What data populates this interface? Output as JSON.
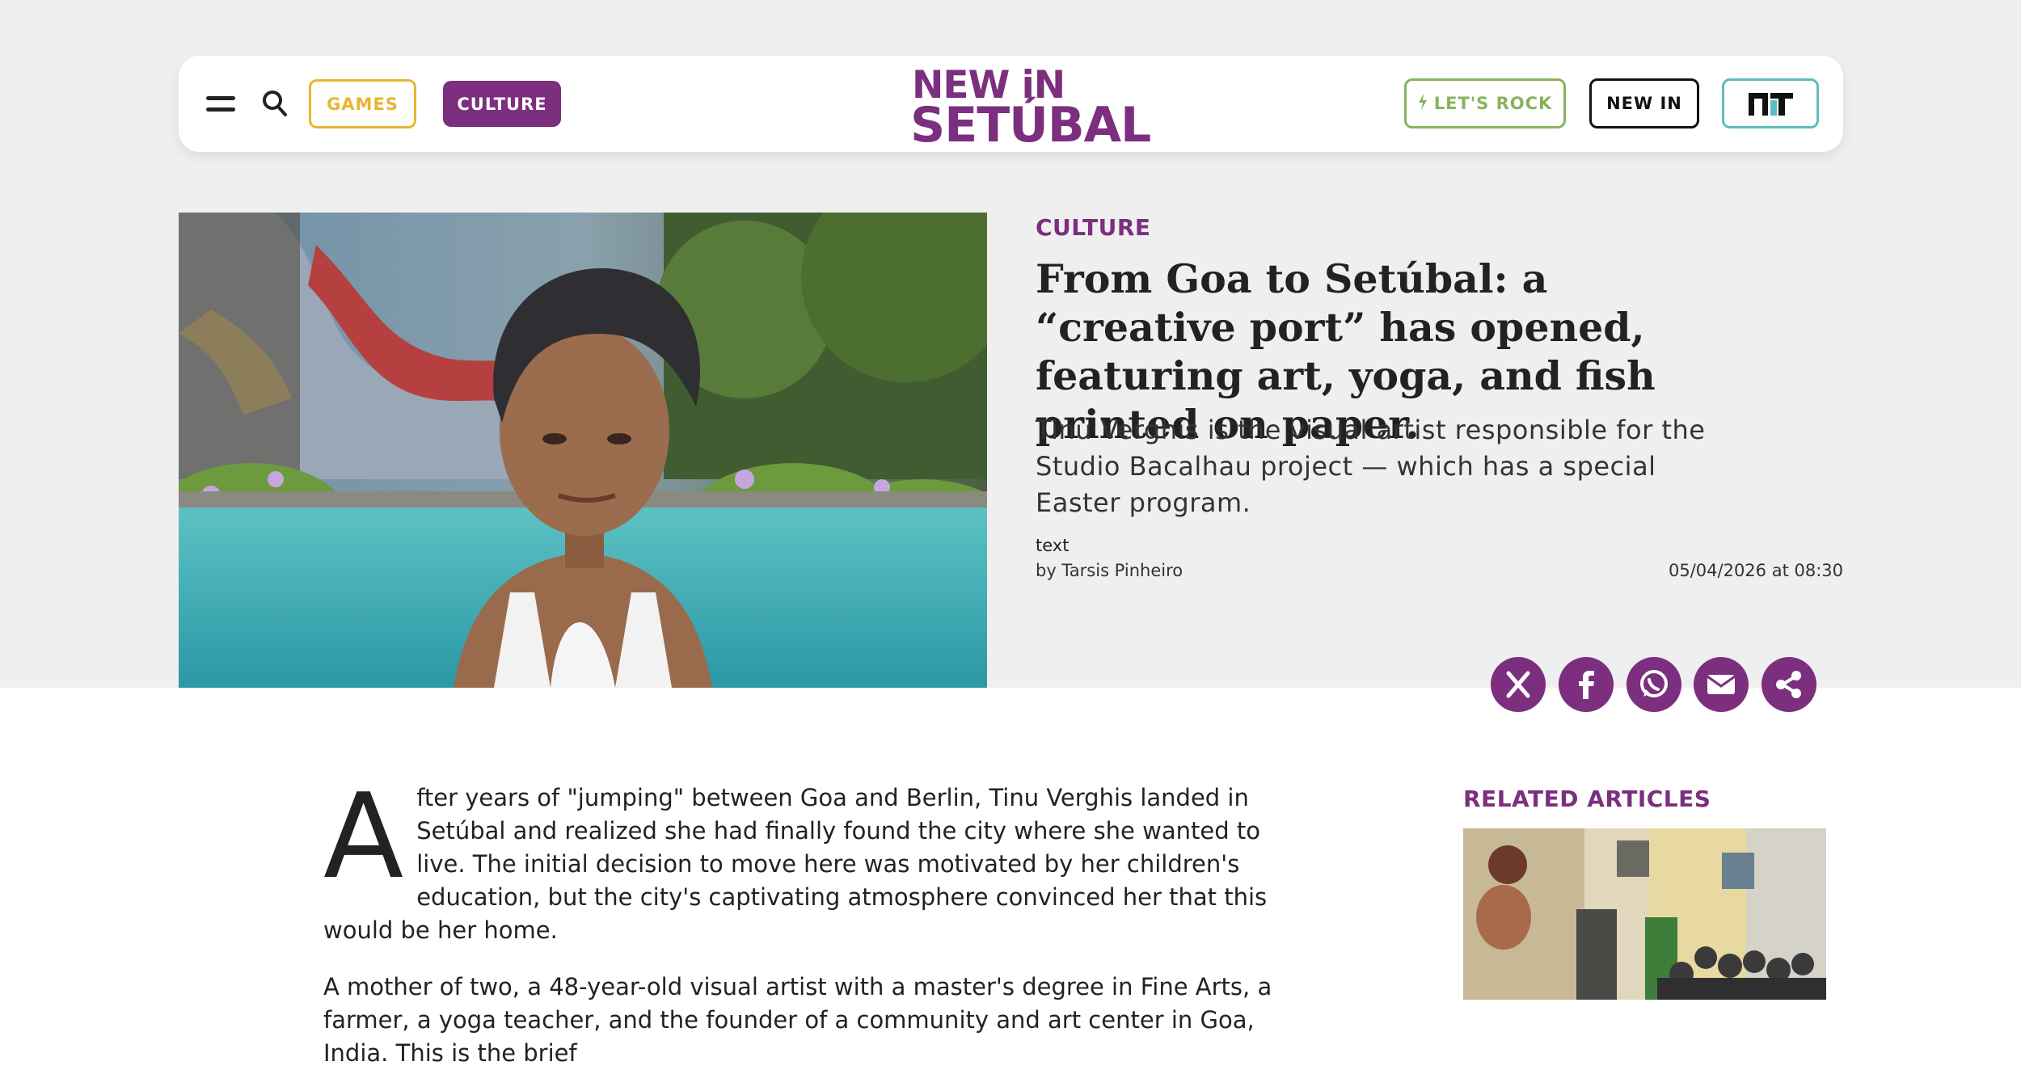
{
  "header": {
    "nav_games": "GAMES",
    "nav_culture": "CULTURE",
    "logo_line1": "NEW iN",
    "logo_line2": "SETÚBAL",
    "lets_rock": "LET'S ROCK",
    "new_in": "NEW IN",
    "icons": [
      "hamburger-menu-icon",
      "search-icon",
      "lightning-bolt-icon",
      "nt-logo-icon"
    ]
  },
  "article": {
    "section": "CULTURE",
    "headline": "From Goa to Setúbal: a “creative port” has opened, featuring art, yoga, and fish printed on paper.",
    "subheadline": "Tinu Verghis is the visual artist responsible for the Studio Bacalhau project — which has a special Easter program.",
    "meta_label": "text",
    "byline": "by Tarsis Pinheiro",
    "datetime": "05/04/2026 at 08:30",
    "share_icons": [
      "x-icon",
      "facebook-icon",
      "whatsapp-icon",
      "email-icon",
      "share-icon"
    ],
    "dropcap": "A",
    "para1_rest": "fter years of \"jumping\" between Goa and Berlin, Tinu Verghis landed in Setúbal and realized she had finally found the city where she wanted to live. The initial decision to move here was motivated by her children's education, but the city's captivating atmosphere convinced her that this would be her home.",
    "para2": "A mother of two, a 48-year-old visual artist with a master's degree in Fine Arts, a farmer, a yoga teacher, and the founder of a community and art center in Goa, India. This is the brief"
  },
  "sidebar": {
    "related_title": "RELATED ARTICLES"
  },
  "colors": {
    "brand_purple": "#7b2f7e",
    "games_yellow": "#e8b532",
    "rock_green": "#87b35c",
    "nt_teal": "#5fbcbc",
    "band_gray": "#efefef"
  }
}
